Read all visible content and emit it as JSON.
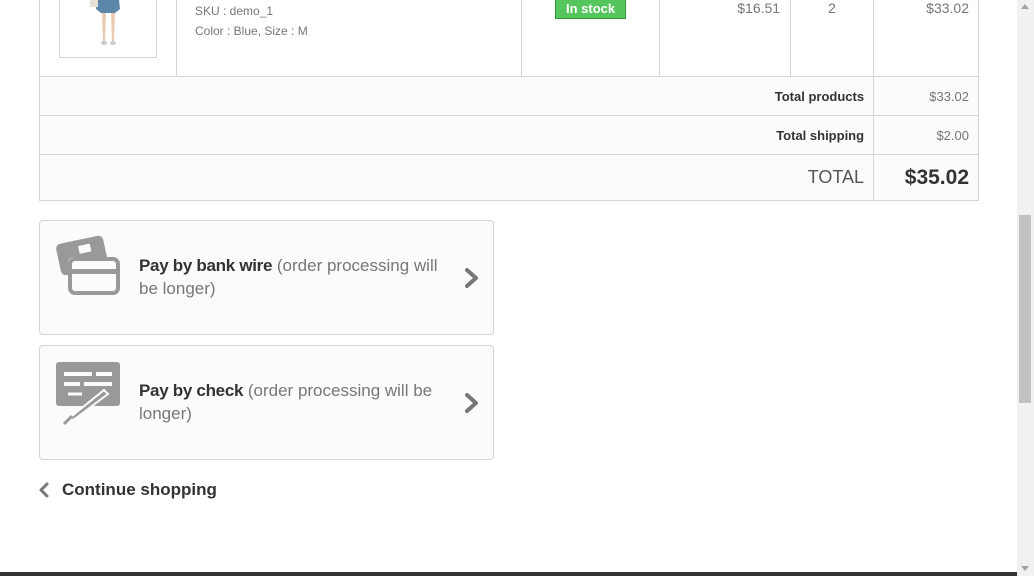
{
  "product": {
    "sku": "SKU : demo_1",
    "attributes": "Color : Blue, Size : M",
    "availability": "In stock",
    "unit_price": "$16.51",
    "quantity": "2",
    "total": "$33.02"
  },
  "summary": {
    "total_products_label": "Total products",
    "total_products_value": "$33.02",
    "total_shipping_label": "Total shipping",
    "total_shipping_value": "$2.00",
    "total_label": "TOTAL",
    "total_value": "$35.02"
  },
  "payment": [
    {
      "method": "Pay by bank wire",
      "note": "(order processing will be longer)",
      "icon": "credit-card-icon"
    },
    {
      "method": "Pay by check",
      "note": "(order processing will be longer)",
      "icon": "check-pen-icon"
    }
  ],
  "continue_label": "Continue shopping",
  "colors": {
    "in_stock": "#55c65e",
    "border": "#d6d4d4",
    "icon_gray": "#999999"
  }
}
